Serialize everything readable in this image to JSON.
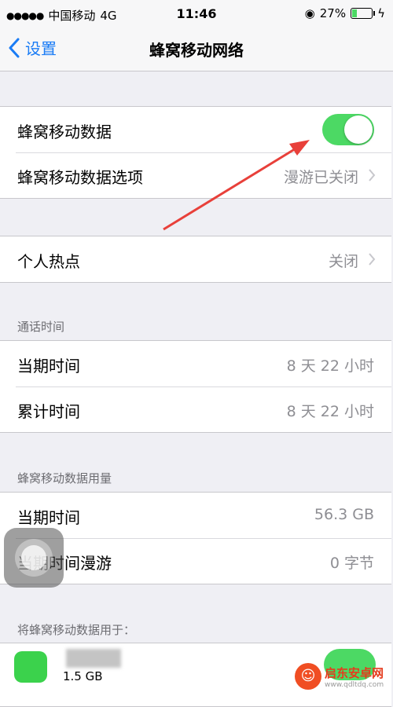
{
  "status_bar": {
    "carrier": "中国移动",
    "network": "4G",
    "time": "11:46",
    "battery_percent": "27%",
    "battery_level": 0.27
  },
  "nav": {
    "back_label": "设置",
    "title": "蜂窝移动网络"
  },
  "cellular": {
    "data_label": "蜂窝移动数据",
    "data_enabled": true,
    "options_label": "蜂窝移动数据选项",
    "options_value": "漫游已关闭"
  },
  "hotspot": {
    "label": "个人热点",
    "value": "关闭"
  },
  "call_time": {
    "header": "通话时间",
    "rows": [
      {
        "label": "当期时间",
        "value": "8 天 22 小时"
      },
      {
        "label": "累计时间",
        "value": "8 天 22 小时"
      }
    ]
  },
  "data_usage": {
    "header": "蜂窝移动数据用量",
    "rows": [
      {
        "label": "当期时间",
        "value": "56.3 GB"
      },
      {
        "label": "当期时间漫游",
        "value": "0 字节"
      }
    ]
  },
  "apps": {
    "header": "将蜂窝移动数据用于：",
    "first_app_usage": "1.5 GB"
  },
  "watermark": {
    "title": "启东安卓网",
    "url": "www.qdltdq.com"
  },
  "colors": {
    "accent": "#1a7cf5",
    "toggle_on": "#4cd964",
    "annotation_arrow": "#e8403a"
  }
}
